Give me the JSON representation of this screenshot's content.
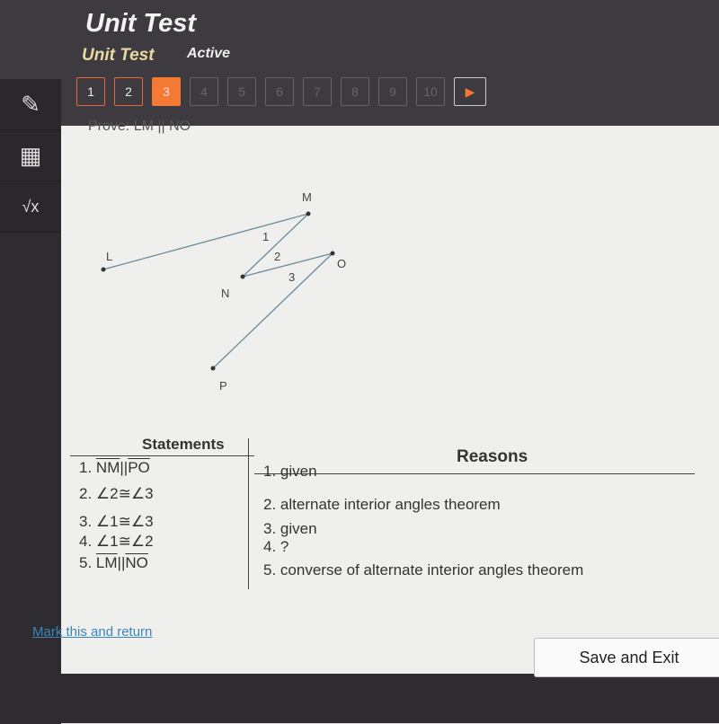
{
  "header": {
    "title": "Unit Test",
    "subtitle": "Unit Test",
    "status": "Active"
  },
  "questions": [
    "1",
    "2",
    "3",
    "4",
    "5",
    "6",
    "7",
    "8",
    "9",
    "10"
  ],
  "current_question": 3,
  "answered": [
    1,
    2
  ],
  "next_icon": "play-arrow-icon",
  "tools": [
    "pencil-icon",
    "calculator-icon",
    "formula-icon"
  ],
  "prompt": "Prove: LM || NO",
  "diagram": {
    "points": {
      "L": "L",
      "M": "M",
      "N": "N",
      "O": "O",
      "P": "P"
    },
    "angles": [
      "1",
      "2",
      "3"
    ]
  },
  "proof": {
    "statements_header": "Statements",
    "reasons_header": "Reasons",
    "statements": [
      {
        "num": "1.",
        "a": "NM",
        "op": "||",
        "b": "PO"
      },
      {
        "num": "2.",
        "a": "∠2",
        "op": "≅",
        "b": "∠3"
      },
      {
        "num": "3.",
        "a": "∠1",
        "op": "≅",
        "b": "∠3"
      },
      {
        "num": "4.",
        "a": "∠1",
        "op": "≅",
        "b": "∠2"
      },
      {
        "num": "5.",
        "a": "LM",
        "op": "||",
        "b": "NO"
      }
    ],
    "reasons": [
      {
        "num": "1.",
        "text": "given"
      },
      {
        "num": "2.",
        "text": "alternate interior angles theorem"
      },
      {
        "num": "3.",
        "text": "given"
      },
      {
        "num": "4.",
        "text": "?"
      },
      {
        "num": "5.",
        "text": "converse of alternate interior angles theorem"
      }
    ]
  },
  "footer": {
    "mark_link": "Mark this and return",
    "save_button": "Save and Exit"
  },
  "colors": {
    "accent": "#f47a33",
    "link": "#3b86b8"
  }
}
